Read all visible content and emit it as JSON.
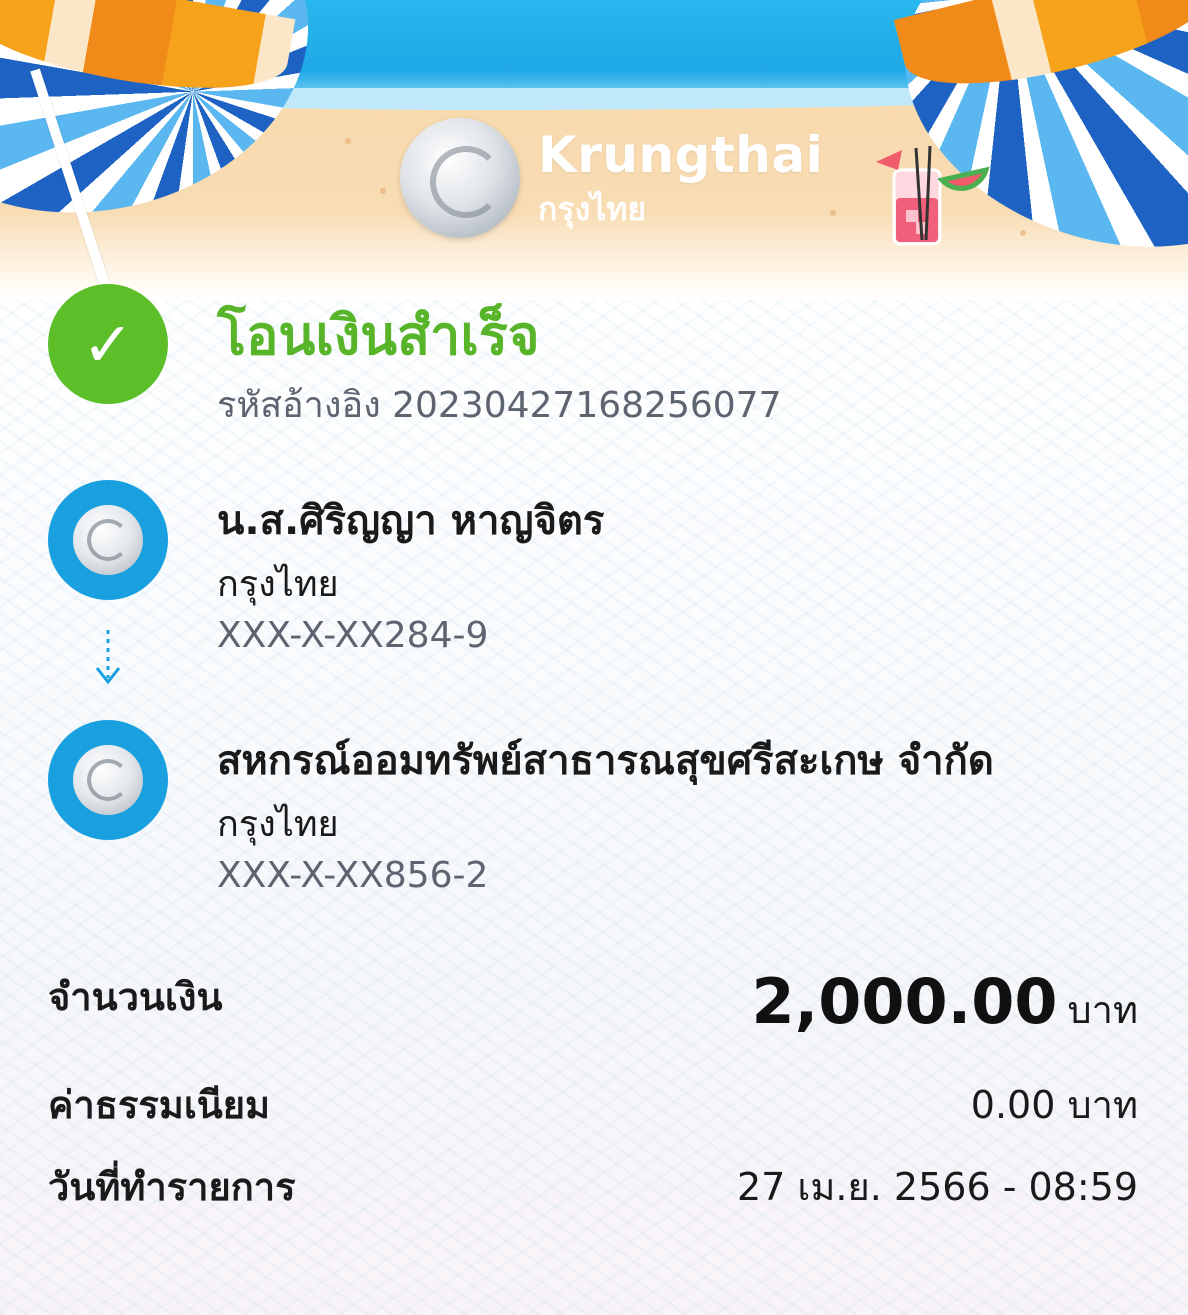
{
  "header": {
    "brand_en": "Krungthai",
    "brand_th": "กรุงไทย"
  },
  "status": {
    "title": "โอนเงินสำเร็จ",
    "reference": "รหัสอ้างอิง 20230427168256077",
    "icon": "check-icon"
  },
  "sender": {
    "name": "น.ส.ศิริญญา หาญจิตร",
    "bank": "กรุงไทย",
    "account": "XXX-X-XX284-9"
  },
  "receiver": {
    "name": "สหกรณ์ออมทรัพย์สาธารณสุขศรีสะเกษ จำกัด",
    "bank": "กรุงไทย",
    "account": "XXX-X-XX856-2"
  },
  "details": {
    "amount_label": "จำนวนเงิน",
    "amount_value": "2,000.00",
    "amount_unit": "บาท",
    "fee_label": "ค่าธรรมเนียม",
    "fee_value": "0.00 บาท",
    "date_label": "วันที่ทำรายการ",
    "date_value": "27 เม.ย. 2566 - 08:59"
  },
  "colors": {
    "success_green": "#58b52a",
    "bank_blue": "#1aa0e0",
    "secondary_text": "#5d6470"
  }
}
